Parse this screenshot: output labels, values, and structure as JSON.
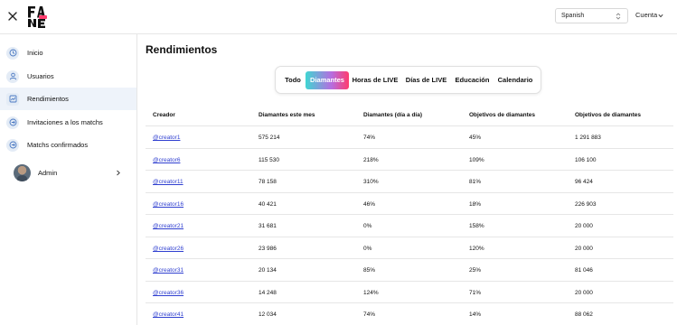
{
  "header": {
    "language": {
      "selected": "Spanish"
    },
    "account_label": "Cuenta"
  },
  "sidebar": {
    "items": [
      {
        "label": "Inicio",
        "icon": "clock-icon"
      },
      {
        "label": "Usuarios",
        "icon": "user-icon"
      },
      {
        "label": "Rendimientos",
        "icon": "chart-icon",
        "active": true
      },
      {
        "label": "Invitaciones a los matchs",
        "icon": "link-icon"
      },
      {
        "label": "Matchs confirmados",
        "icon": "link-icon"
      }
    ],
    "user": {
      "name": "Admin"
    }
  },
  "main": {
    "title": "Rendimientos",
    "tabs": [
      {
        "label": "Todo"
      },
      {
        "label": "Diamantes",
        "active": true
      },
      {
        "label": "Horas de LIVE"
      },
      {
        "label": "Días de LIVE"
      },
      {
        "label": "Educación"
      },
      {
        "label": "Calendario"
      }
    ],
    "table": {
      "columns": [
        "Creador",
        "Diamantes este mes",
        "Diamantes (día a día)",
        "Objetivos de diamantes",
        "Objetivos de diamantes"
      ],
      "rows": [
        [
          "@creator1",
          "575 214",
          "74%",
          "45%",
          "1 291 883"
        ],
        [
          "@creator6",
          "115 530",
          "218%",
          "109%",
          "106 100"
        ],
        [
          "@creator11",
          "78 158",
          "310%",
          "81%",
          "96 424"
        ],
        [
          "@creator16",
          "40 421",
          "46%",
          "18%",
          "226 903"
        ],
        [
          "@creator21",
          "31 681",
          "0%",
          "158%",
          "20 000"
        ],
        [
          "@creator26",
          "23 986",
          "0%",
          "120%",
          "20 000"
        ],
        [
          "@creator31",
          "20 134",
          "85%",
          "25%",
          "81 046"
        ],
        [
          "@creator36",
          "14 248",
          "124%",
          "71%",
          "20 000"
        ],
        [
          "@creator41",
          "12 034",
          "74%",
          "14%",
          "88 062"
        ]
      ]
    }
  },
  "colors": {
    "accent_gradient": [
      "#3fd6d2",
      "#b66de0",
      "#ff3d6e"
    ],
    "link": "#2f3fd0",
    "active_nav_bg": "#eef3fa"
  }
}
